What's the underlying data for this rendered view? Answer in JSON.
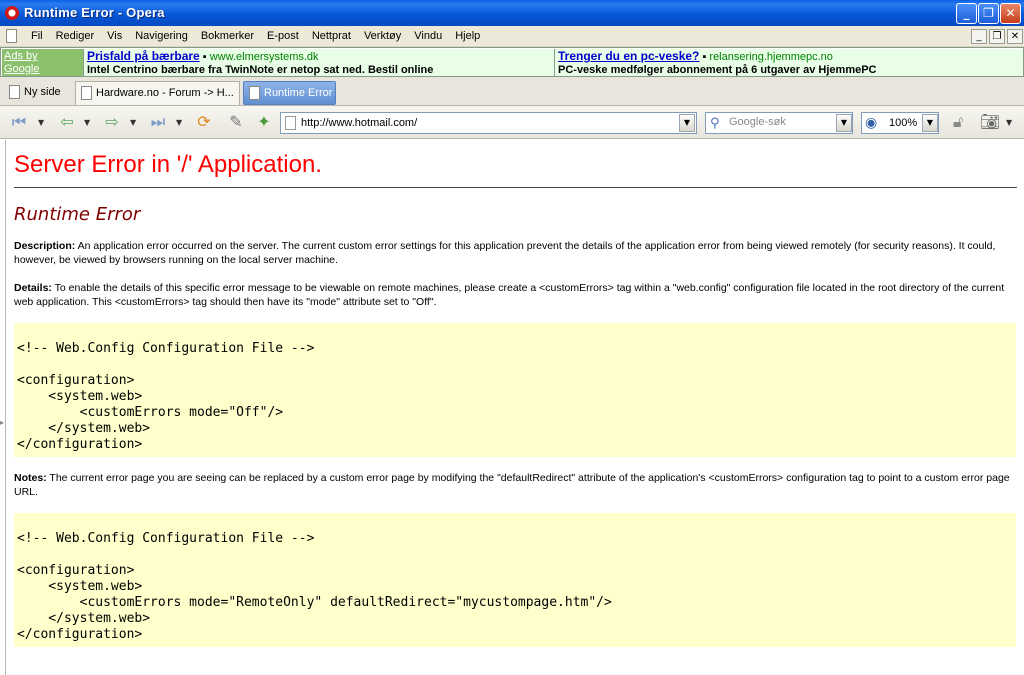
{
  "window": {
    "title": "Runtime Error - Opera"
  },
  "menubar": {
    "items": [
      "Fil",
      "Rediger",
      "Vis",
      "Navigering",
      "Bokmerker",
      "E-post",
      "Nettprat",
      "Verktøy",
      "Vindu",
      "Hjelp"
    ]
  },
  "ads": {
    "label": [
      "Ads by",
      "Google"
    ],
    "ad1": {
      "title": "Prisfald på bærbare",
      "sep": " ▪ ",
      "url": "www.elmersystems.dk",
      "text": "Intel Centrino bærbare fra TwinNote er netop sat ned. Bestil online"
    },
    "ad2": {
      "title": "Trenger du en pc-veske?",
      "sep": " ▪ ",
      "url": "relansering.hjemmepc.no",
      "text": "PC-veske medfølger abonnement på 6 utgaver av HjemmePC"
    }
  },
  "tabs": [
    {
      "label": "Ny side"
    },
    {
      "label": "Hardware.no - Forum -> H..."
    },
    {
      "label": "Runtime Error"
    }
  ],
  "toolbar": {
    "address": "http://www.hotmail.com/",
    "search_placeholder": "Google-søk",
    "zoom": "100%"
  },
  "content": {
    "heading": "Server Error in '/' Application.",
    "subheading": "Runtime Error",
    "description_label": "Description:",
    "description_text": " An application error occurred on the server. The current custom error settings for this application prevent the details of the application error from being viewed remotely (for security reasons). It could, however, be viewed by browsers running on the local server machine.",
    "details_label": "Details:",
    "details_text": " To enable the details of this specific error message to be viewable on remote machines, please create a <customErrors> tag within a \"web.config\" configuration file located in the root directory of the current web application. This <customErrors> tag should then have its \"mode\" attribute set to \"Off\".",
    "code1": "<!-- Web.Config Configuration File -->\n\n<configuration>\n    <system.web>\n        <customErrors mode=\"Off\"/>\n    </system.web>\n</configuration>",
    "notes_label": "Notes:",
    "notes_text": " The current error page you are seeing can be replaced by a custom error page by modifying the \"defaultRedirect\" attribute of the application's <customErrors> configuration tag to point to a custom error page URL.",
    "code2": "<!-- Web.Config Configuration File -->\n\n<configuration>\n    <system.web>\n        <customErrors mode=\"RemoteOnly\" defaultRedirect=\"mycustompage.htm\"/>\n    </system.web>\n</configuration>"
  },
  "colors": {
    "heading": "#ff0000",
    "subheading": "#800000",
    "code_bg": "#ffffcc",
    "titlebar": "#0758d8"
  }
}
